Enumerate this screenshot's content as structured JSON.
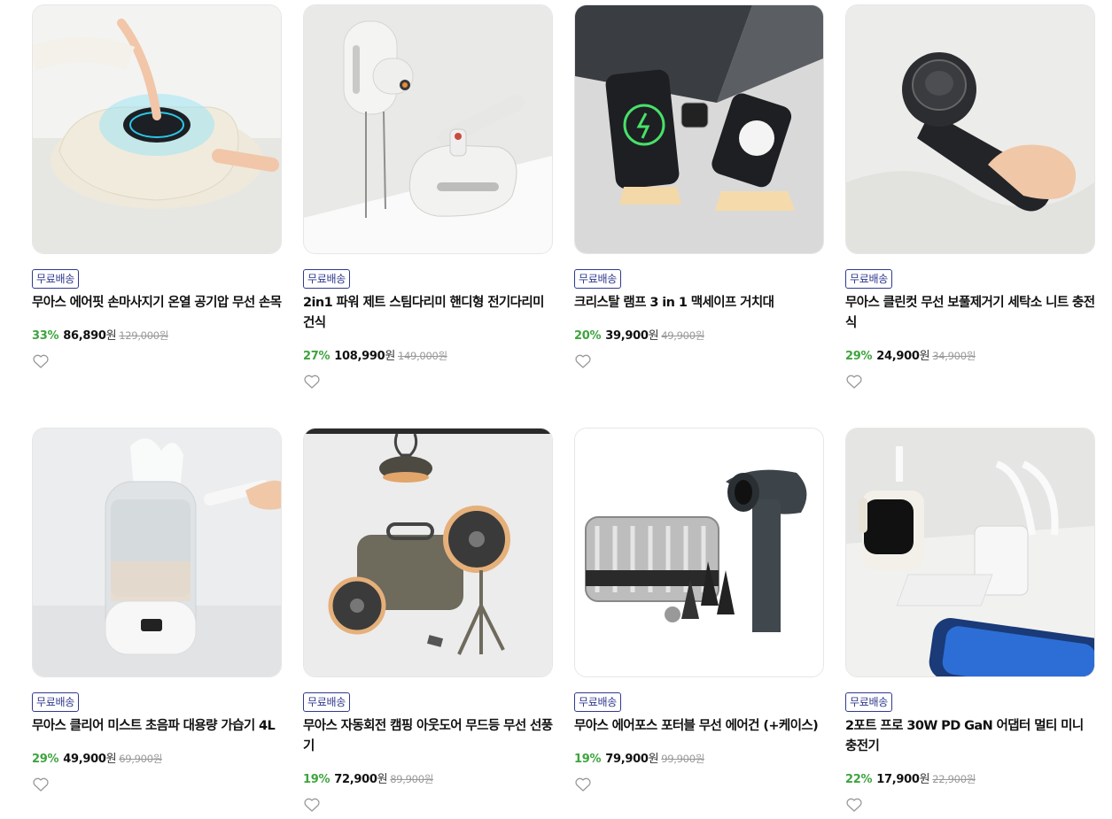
{
  "products": [
    {
      "badge": "무료배송",
      "title": "무아스 에어핏 손마사지기 온열 공기압 무선 손목",
      "discount": "33%",
      "price": "86,890",
      "currency": "원",
      "original": "129,000원",
      "wish_icon": "heart-outline-icon",
      "image": "hand-massager"
    },
    {
      "badge": "무료배송",
      "title": "2in1 파워 제트 스팀다리미 핸디형 전기다리미 건식",
      "discount": "27%",
      "price": "108,990",
      "currency": "원",
      "original": "149,000원",
      "wish_icon": "heart-outline-icon",
      "image": "steam-iron"
    },
    {
      "badge": "무료배송",
      "title": "크리스탈 램프 3 in 1 맥세이프 거치대",
      "discount": "20%",
      "price": "39,900",
      "currency": "원",
      "original": "49,900원",
      "wish_icon": "heart-outline-icon",
      "image": "magsafe-stand"
    },
    {
      "badge": "무료배송",
      "title": "무아스 클린컷 무선 보풀제거기 세탁소 니트 충전식",
      "discount": "29%",
      "price": "24,900",
      "currency": "원",
      "original": "34,900원",
      "wish_icon": "heart-outline-icon",
      "image": "lint-remover"
    },
    {
      "badge": "무료배송",
      "title": "무아스 클리어 미스트 초음파 대용량 가습기 4L",
      "discount": "29%",
      "price": "49,900",
      "currency": "원",
      "original": "69,900원",
      "wish_icon": "heart-outline-icon",
      "image": "humidifier"
    },
    {
      "badge": "무료배송",
      "title": "무아스 자동회전 캠핑 아웃도어 무드등 무선 선풍기",
      "discount": "19%",
      "price": "72,900",
      "currency": "원",
      "original": "89,900원",
      "wish_icon": "heart-outline-icon",
      "image": "camping-fan"
    },
    {
      "badge": "무료배송",
      "title": "무아스 에어포스 포터블 무선 에어건 (+케이스)",
      "discount": "19%",
      "price": "79,900",
      "currency": "원",
      "original": "99,900원",
      "wish_icon": "heart-outline-icon",
      "image": "air-gun"
    },
    {
      "badge": "무료배송",
      "title": "2포트 프로 30W PD GaN 어댑터 멀티 미니 충전기",
      "discount": "22%",
      "price": "17,900",
      "currency": "원",
      "original": "22,900원",
      "wish_icon": "heart-outline-icon",
      "image": "gan-charger"
    }
  ],
  "colors": {
    "badge": "#2f3a8f",
    "discount": "#3ea43e",
    "original_price": "#999999"
  }
}
